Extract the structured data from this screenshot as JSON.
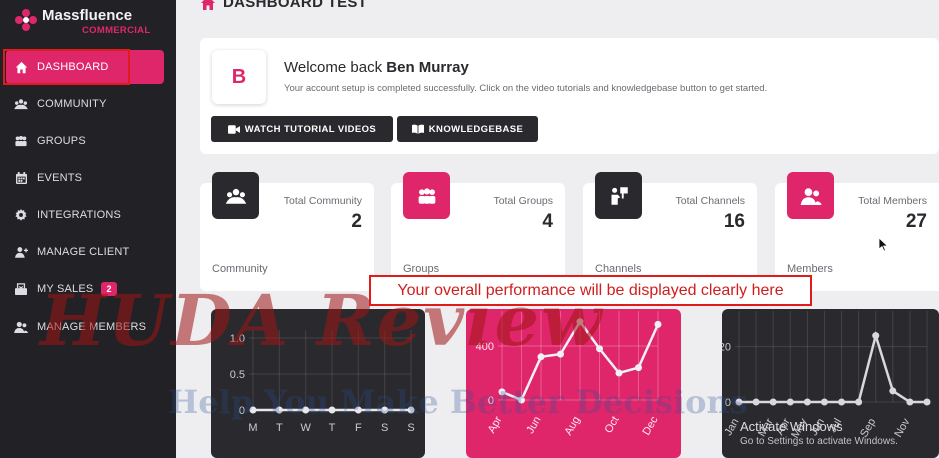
{
  "app": {
    "name": "Massfluence",
    "subname": "COMMERCIAL"
  },
  "sidebar": {
    "items": [
      {
        "label": "DASHBOARD",
        "icon": "home-icon",
        "active": true
      },
      {
        "label": "COMMUNITY",
        "icon": "community-icon"
      },
      {
        "label": "GROUPS",
        "icon": "groups-icon"
      },
      {
        "label": "EVENTS",
        "icon": "calendar-icon"
      },
      {
        "label": "INTEGRATIONS",
        "icon": "gear-icon"
      },
      {
        "label": "MANAGE CLIENT",
        "icon": "user-icon"
      },
      {
        "label": "MY SALES",
        "icon": "sales-icon",
        "badge": "2"
      },
      {
        "label": "MANAGE MEMBERS",
        "icon": "users-icon"
      }
    ]
  },
  "page": {
    "title": "DASHBOARD TEST"
  },
  "welcome": {
    "avatar_letter": "B",
    "greeting": "Welcome back",
    "user_name": "Ben Murray",
    "message": "Your account setup is completed successfully. Click on the video tutorials and knowledgebase button to get started.",
    "buttons": {
      "tutorials": "WATCH TUTORIAL VIDEOS",
      "knowledgebase": "KNOWLEDGEBASE"
    }
  },
  "stats": [
    {
      "label": "Total Community",
      "value": "2",
      "footer": "Community",
      "icon": "community-icon",
      "color": "#2a2a2e"
    },
    {
      "label": "Total Groups",
      "value": "4",
      "footer": "Groups",
      "icon": "groups-icon",
      "color": "#e0266b"
    },
    {
      "label": "Total Channels",
      "value": "16",
      "footer": "Channels",
      "icon": "channel-icon",
      "color": "#2a2a2e"
    },
    {
      "label": "Total Members",
      "value": "27",
      "footer": "Members",
      "icon": "users-icon",
      "color": "#e0266b"
    }
  ],
  "annotation": "Your overall performance will be displayed clearly here",
  "watermark": {
    "line1": "HUDA Review",
    "line2": "Help You Make Better Decisions"
  },
  "os_notice": {
    "title": "Activate Windows",
    "subtitle": "Go to Settings to activate Windows."
  },
  "colors": {
    "accent": "#e0266b",
    "sidebar": "#222226",
    "dark_card": "#2a2a2e",
    "annotation_red": "#e01b1b"
  },
  "chart_data": [
    {
      "type": "line",
      "x": [
        "M",
        "T",
        "W",
        "T",
        "F",
        "S",
        "S"
      ],
      "y_ticks": [
        "1.0",
        "0.5",
        "0"
      ],
      "ylim": [
        0,
        1
      ],
      "series": [
        {
          "values": [
            0,
            0,
            0,
            0,
            0,
            0,
            0
          ]
        }
      ],
      "background": "#2a2a2e"
    },
    {
      "type": "line",
      "x": [
        "Apr",
        "May",
        "Jun",
        "Jul",
        "Aug",
        "Sep",
        "Oct",
        "Nov",
        "Dec"
      ],
      "x_ticks_shown": [
        "Apr",
        "Jun",
        "Aug",
        "Oct",
        "Dec"
      ],
      "y_ticks": [
        "400",
        "0"
      ],
      "ylim": [
        0,
        600
      ],
      "series": [
        {
          "values": [
            60,
            0,
            320,
            340,
            580,
            380,
            200,
            240,
            560
          ]
        }
      ],
      "background": "#e0266b"
    },
    {
      "type": "line",
      "x": [
        "Jan",
        "Feb",
        "Mar",
        "Apr",
        "May",
        "Jun",
        "Jul",
        "Aug",
        "Sep",
        "Oct",
        "Nov",
        "Dec"
      ],
      "x_ticks_shown": [
        "Jan",
        "Mar",
        "Apr",
        "May",
        "Jun",
        "Jul",
        "Sep",
        "Nov"
      ],
      "y_ticks": [
        "20",
        "0"
      ],
      "ylim": [
        0,
        30
      ],
      "series": [
        {
          "values": [
            0,
            0,
            0,
            0,
            0,
            0,
            0,
            0,
            24,
            4,
            0,
            0
          ]
        }
      ],
      "background": "#2a2a2e"
    }
  ]
}
